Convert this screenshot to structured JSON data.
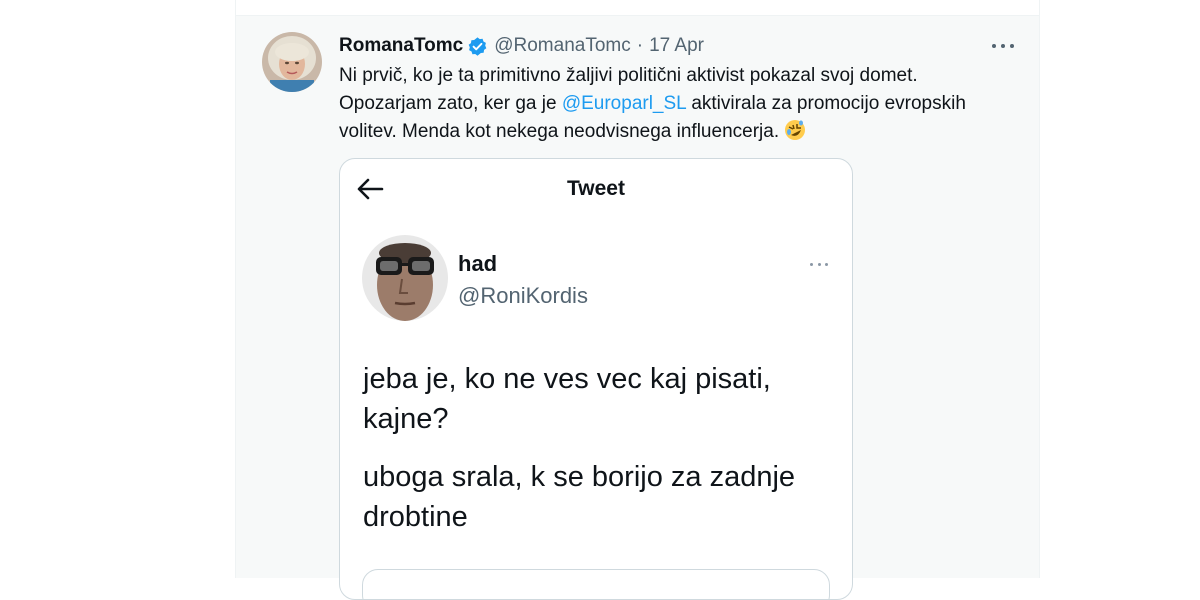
{
  "tweet": {
    "display_name": "RomanaTomc",
    "handle": "@RomanaTomc",
    "separator": "·",
    "date": "17 Apr",
    "text_part1": "Ni prvič, ko je ta primitivno žaljivi politični aktivist pokazal svoj domet. Opozarjam zato, ker ga je ",
    "mention": "@Europarl_SL",
    "text_part2": " aktivirala za promocijo evropskih volitev. Menda kot nekega neodvisnega influencerja. ",
    "emoji_icon": "rolling-on-floor-laughing-emoji",
    "verified_color": "#1d9bf0"
  },
  "embedded": {
    "header_title": "Tweet",
    "name": "had",
    "handle": "@RoniKordis",
    "text1": "jeba je, ko ne ves vec kaj pisati, kajne?",
    "text2": "uboga srala, k se borijo za zadnje drobtine"
  },
  "colors": {
    "accent": "#1d9bf0",
    "text": "#0f1419",
    "secondary": "#536471",
    "column_bg": "#f7f9f9"
  }
}
